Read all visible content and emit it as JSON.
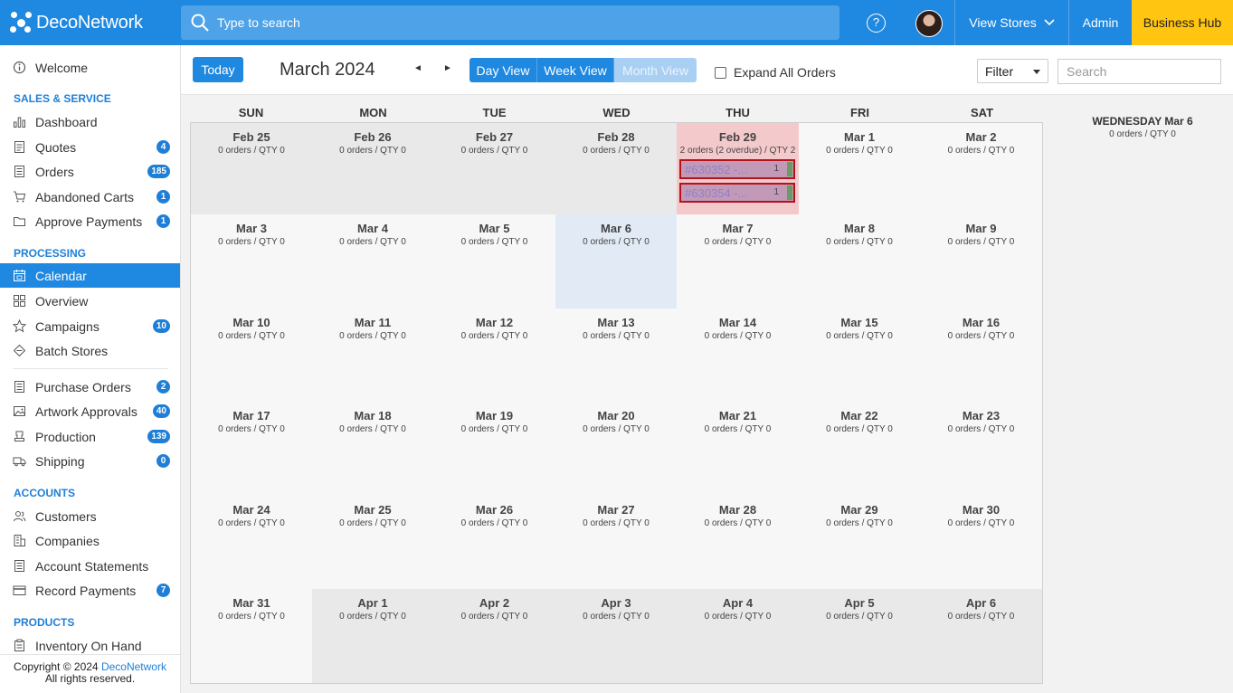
{
  "header": {
    "logo": "DecoNetwork",
    "search_placeholder": "Type to search",
    "help": "?",
    "view_stores": "View Stores",
    "admin": "Admin",
    "business_hub": "Business Hub"
  },
  "sidebar": {
    "welcome": "Welcome",
    "sections": {
      "sales": "SALES & SERVICE",
      "processing": "PROCESSING",
      "accounts": "ACCOUNTS",
      "products": "PRODUCTS"
    },
    "items": [
      {
        "label": "Dashboard",
        "badge": ""
      },
      {
        "label": "Quotes",
        "badge": "4"
      },
      {
        "label": "Orders",
        "badge": "185"
      },
      {
        "label": "Abandoned Carts",
        "badge": "1"
      },
      {
        "label": "Approve Payments",
        "badge": "1"
      },
      {
        "label": "Calendar",
        "badge": ""
      },
      {
        "label": "Overview",
        "badge": ""
      },
      {
        "label": "Campaigns",
        "badge": "10"
      },
      {
        "label": "Batch Stores",
        "badge": ""
      },
      {
        "label": "Purchase Orders",
        "badge": "2"
      },
      {
        "label": "Artwork Approvals",
        "badge": "40"
      },
      {
        "label": "Production",
        "badge": "139"
      },
      {
        "label": "Shipping",
        "badge": "0"
      },
      {
        "label": "Customers",
        "badge": ""
      },
      {
        "label": "Companies",
        "badge": ""
      },
      {
        "label": "Account Statements",
        "badge": ""
      },
      {
        "label": "Record Payments",
        "badge": "7"
      },
      {
        "label": "Inventory On Hand",
        "badge": ""
      }
    ],
    "copyright": "Copyright © 2024",
    "copyright_link": "DecoNetwork",
    "rights": "All rights reserved."
  },
  "toolbar": {
    "today": "Today",
    "month_title": "March 2024",
    "prev": "◄",
    "next": "►",
    "views": [
      "Day View",
      "Week View",
      "Month View"
    ],
    "expand_label": "Expand All Orders",
    "filter": "Filter",
    "search_placeholder": "Search"
  },
  "calendar": {
    "days_of_week": [
      "SUN",
      "MON",
      "TUE",
      "WED",
      "THU",
      "FRI",
      "SAT"
    ],
    "weeks": [
      [
        {
          "date": "Feb 25",
          "meta": "0 orders / QTY 0"
        },
        {
          "date": "Feb 26",
          "meta": "0 orders / QTY 0"
        },
        {
          "date": "Feb 27",
          "meta": "0 orders / QTY 0"
        },
        {
          "date": "Feb 28",
          "meta": "0 orders / QTY 0"
        },
        {
          "date": "Feb 29",
          "meta": "2 orders (2 overdue) / QTY 2",
          "orders": [
            {
              "num": "#630352 -...",
              "qty": "1"
            },
            {
              "num": "#630354 -...",
              "qty": "1"
            }
          ]
        },
        {
          "date": "Mar 1",
          "meta": "0 orders / QTY 0"
        },
        {
          "date": "Mar 2",
          "meta": "0 orders / QTY 0"
        }
      ],
      [
        {
          "date": "Mar 3",
          "meta": "0 orders / QTY 0"
        },
        {
          "date": "Mar 4",
          "meta": "0 orders / QTY 0"
        },
        {
          "date": "Mar 5",
          "meta": "0 orders / QTY 0"
        },
        {
          "date": "Mar 6",
          "meta": "0 orders / QTY 0"
        },
        {
          "date": "Mar 7",
          "meta": "0 orders / QTY 0"
        },
        {
          "date": "Mar 8",
          "meta": "0 orders / QTY 0"
        },
        {
          "date": "Mar 9",
          "meta": "0 orders / QTY 0"
        }
      ],
      [
        {
          "date": "Mar 10",
          "meta": "0 orders / QTY 0"
        },
        {
          "date": "Mar 11",
          "meta": "0 orders / QTY 0"
        },
        {
          "date": "Mar 12",
          "meta": "0 orders / QTY 0"
        },
        {
          "date": "Mar 13",
          "meta": "0 orders / QTY 0"
        },
        {
          "date": "Mar 14",
          "meta": "0 orders / QTY 0"
        },
        {
          "date": "Mar 15",
          "meta": "0 orders / QTY 0"
        },
        {
          "date": "Mar 16",
          "meta": "0 orders / QTY 0"
        }
      ],
      [
        {
          "date": "Mar 17",
          "meta": "0 orders / QTY 0"
        },
        {
          "date": "Mar 18",
          "meta": "0 orders / QTY 0"
        },
        {
          "date": "Mar 19",
          "meta": "0 orders / QTY 0"
        },
        {
          "date": "Mar 20",
          "meta": "0 orders / QTY 0"
        },
        {
          "date": "Mar 21",
          "meta": "0 orders / QTY 0"
        },
        {
          "date": "Mar 22",
          "meta": "0 orders / QTY 0"
        },
        {
          "date": "Mar 23",
          "meta": "0 orders / QTY 0"
        }
      ],
      [
        {
          "date": "Mar 24",
          "meta": "0 orders / QTY 0"
        },
        {
          "date": "Mar 25",
          "meta": "0 orders / QTY 0"
        },
        {
          "date": "Mar 26",
          "meta": "0 orders / QTY 0"
        },
        {
          "date": "Mar 27",
          "meta": "0 orders / QTY 0"
        },
        {
          "date": "Mar 28",
          "meta": "0 orders / QTY 0"
        },
        {
          "date": "Mar 29",
          "meta": "0 orders / QTY 0"
        },
        {
          "date": "Mar 30",
          "meta": "0 orders / QTY 0"
        }
      ],
      [
        {
          "date": "Mar 31",
          "meta": "0 orders / QTY 0"
        },
        {
          "date": "Apr 1",
          "meta": "0 orders / QTY 0"
        },
        {
          "date": "Apr 2",
          "meta": "0 orders / QTY 0"
        },
        {
          "date": "Apr 3",
          "meta": "0 orders / QTY 0"
        },
        {
          "date": "Apr 4",
          "meta": "0 orders / QTY 0"
        },
        {
          "date": "Apr 5",
          "meta": "0 orders / QTY 0"
        },
        {
          "date": "Apr 6",
          "meta": "0 orders / QTY 0"
        }
      ]
    ]
  },
  "side_panel": {
    "title": "WEDNESDAY Mar 6",
    "meta": "0 orders / QTY 0"
  },
  "colors": {
    "brand_blue": "#1f88e0",
    "business_hub": "#ffc510",
    "overdue_cell": "#f4c9cb",
    "today_cell": "#e2ebf5",
    "order_border": "#b3141c"
  }
}
